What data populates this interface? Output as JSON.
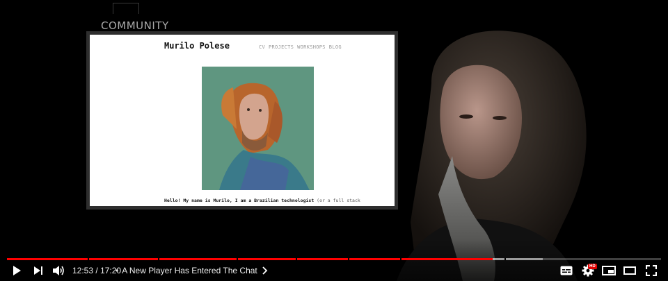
{
  "overlay": {
    "community_label": "COMMUNITY"
  },
  "website": {
    "title": "Murilo Polese",
    "nav": [
      "CV",
      "PROJECTS",
      "WORKSHOPS",
      "BLOG"
    ],
    "intro_bold": "Hello! My name is Murilo, I am a Brazilian technologist",
    "intro_rest": "(or a full stack"
  },
  "player": {
    "time_display": "12:53 / 17:20",
    "chapter_separator": "•",
    "chapter_title": "A New Player Has Entered The Chat",
    "hd_badge": "HD",
    "progress_fraction": 0.743,
    "buffered_fraction": 0.819,
    "chapter_breaks_fraction": [
      0.123,
      0.231,
      0.351,
      0.441,
      0.521,
      0.601,
      0.761
    ],
    "colors": {
      "progress": "#ff0000",
      "hd_badge": "#e00000"
    },
    "icons": [
      "play-icon",
      "next-icon",
      "volume-icon",
      "chevron-right-icon",
      "subtitles-icon",
      "settings-icon",
      "miniplayer-icon",
      "theater-mode-icon",
      "fullscreen-icon"
    ]
  }
}
